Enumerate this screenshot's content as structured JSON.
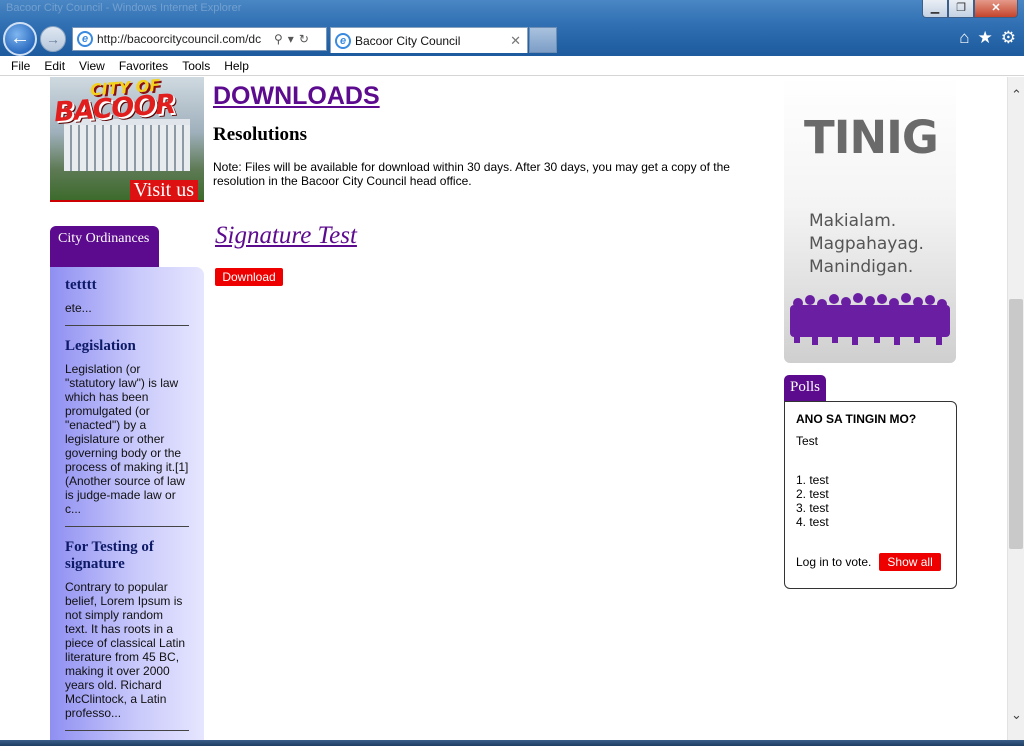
{
  "browser": {
    "window_title": "Bacoor City Council - Windows Internet Explorer",
    "address_url": "http://bacoorcitycouncil.com/dc",
    "tab_title": "Bacoor City Council",
    "menu": [
      "File",
      "Edit",
      "View",
      "Favorites",
      "Tools",
      "Help"
    ]
  },
  "logo": {
    "line1": "CITY OF",
    "line2": "BACOOR",
    "visit": "Visit us"
  },
  "sidebar": {
    "tab_label": "City Ordinances",
    "items": [
      {
        "title": "tetttt",
        "body": "ete..."
      },
      {
        "title": "Legislation",
        "body": "Legislation (or \"statutory law\") is law which has been promulgated (or \"enacted\") by a legislature or other governing body or the process of making it.[1] (Another source of law is judge-made law or c..."
      },
      {
        "title": "For Testing of signature",
        "body": "Contrary to popular belief, Lorem Ipsum is not simply random text. It has roots in a piece of classical Latin literature from 45 BC, making it over 2000 years old. Richard McClintock, a Latin professo..."
      }
    ]
  },
  "main": {
    "heading": "DOWNLOADS",
    "subheading": "Resolutions",
    "note": "Note: Files will be available for download within 30 days. After 30 days, you may get a copy of the resolution in the Bacoor City Council head office.",
    "doc_title": "Signature Test",
    "download_label": "Download"
  },
  "banner": {
    "word": "TINIG",
    "lines": [
      "Makialam.",
      "Magpahayag.",
      "Manindigan."
    ]
  },
  "polls": {
    "tab_label": "Polls",
    "question": "ANO SA TINGIN MO?",
    "description": "Test",
    "options": [
      "1. test",
      "2. test",
      "3. test",
      "4. test"
    ],
    "login_text": "Log in to vote.",
    "show_all_label": "Show all"
  },
  "colors": {
    "brand_purple": "#5c0a8e",
    "accent_red": "#e00000",
    "sidebar_blue": "#8f8ff2"
  }
}
